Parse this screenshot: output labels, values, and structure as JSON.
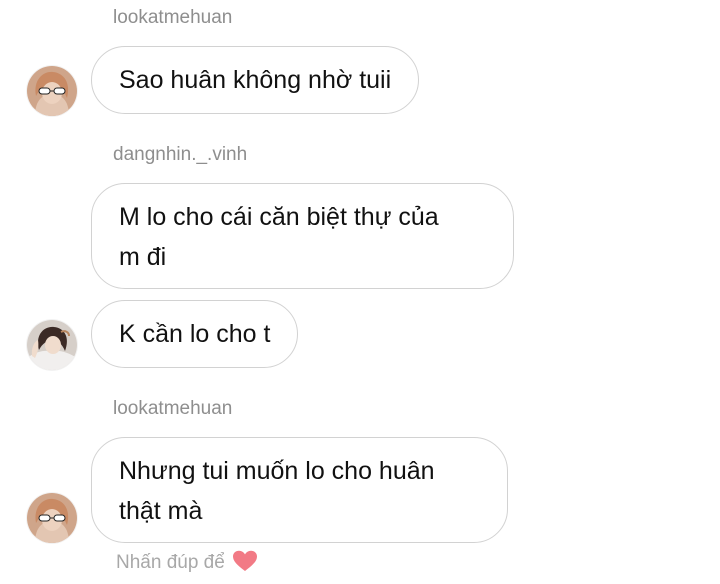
{
  "thread": {
    "messages": [
      {
        "username": "lookatmehuan",
        "text_lines": [
          "Sao huân không nhờ tuii"
        ]
      },
      {
        "username": "dangnhin._.vinh",
        "text_lines": [
          "M lo cho cái căn biệt thự của",
          "m đi"
        ]
      },
      {
        "username": "",
        "text_lines": [
          "K cần lo cho t"
        ]
      },
      {
        "username": "lookatmehuan",
        "text_lines": [
          "Nhưng tui muốn lo cho huân",
          "thật mà"
        ]
      }
    ]
  },
  "footer": {
    "double_tap_hint": "Nhấn đúp để",
    "heart_icon": "heart-icon",
    "heart_color": "#f27a85"
  },
  "colors": {
    "bubble_border": "#d2d2d2",
    "username": "#8e8e8e",
    "text": "#111111"
  }
}
